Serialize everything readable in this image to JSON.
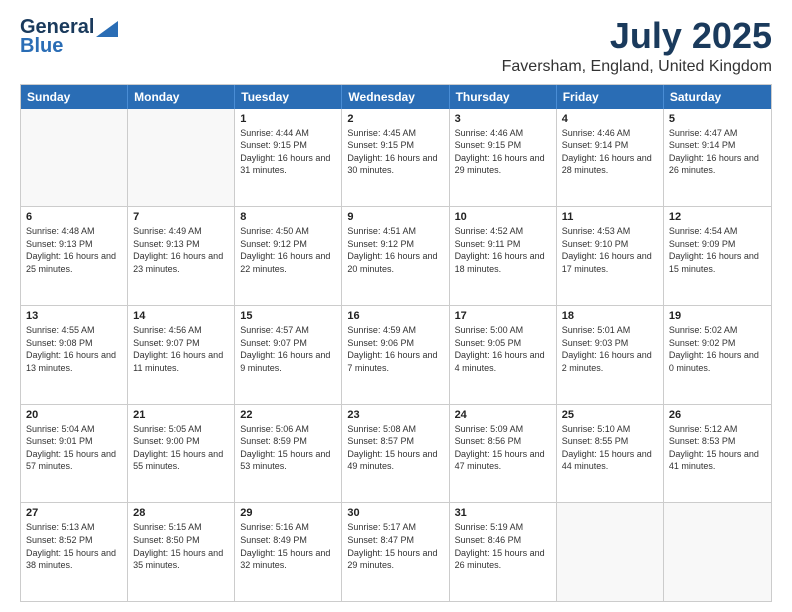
{
  "logo": {
    "name_part1": "General",
    "name_part2": "Blue",
    "tagline": "Blue"
  },
  "header": {
    "month": "July 2025",
    "location": "Faversham, England, United Kingdom"
  },
  "days_of_week": [
    "Sunday",
    "Monday",
    "Tuesday",
    "Wednesday",
    "Thursday",
    "Friday",
    "Saturday"
  ],
  "weeks": [
    [
      {
        "day": "",
        "empty": true
      },
      {
        "day": "",
        "empty": true
      },
      {
        "day": "1",
        "sunrise": "Sunrise: 4:44 AM",
        "sunset": "Sunset: 9:15 PM",
        "daylight": "Daylight: 16 hours and 31 minutes."
      },
      {
        "day": "2",
        "sunrise": "Sunrise: 4:45 AM",
        "sunset": "Sunset: 9:15 PM",
        "daylight": "Daylight: 16 hours and 30 minutes."
      },
      {
        "day": "3",
        "sunrise": "Sunrise: 4:46 AM",
        "sunset": "Sunset: 9:15 PM",
        "daylight": "Daylight: 16 hours and 29 minutes."
      },
      {
        "day": "4",
        "sunrise": "Sunrise: 4:46 AM",
        "sunset": "Sunset: 9:14 PM",
        "daylight": "Daylight: 16 hours and 28 minutes."
      },
      {
        "day": "5",
        "sunrise": "Sunrise: 4:47 AM",
        "sunset": "Sunset: 9:14 PM",
        "daylight": "Daylight: 16 hours and 26 minutes."
      }
    ],
    [
      {
        "day": "6",
        "sunrise": "Sunrise: 4:48 AM",
        "sunset": "Sunset: 9:13 PM",
        "daylight": "Daylight: 16 hours and 25 minutes."
      },
      {
        "day": "7",
        "sunrise": "Sunrise: 4:49 AM",
        "sunset": "Sunset: 9:13 PM",
        "daylight": "Daylight: 16 hours and 23 minutes."
      },
      {
        "day": "8",
        "sunrise": "Sunrise: 4:50 AM",
        "sunset": "Sunset: 9:12 PM",
        "daylight": "Daylight: 16 hours and 22 minutes."
      },
      {
        "day": "9",
        "sunrise": "Sunrise: 4:51 AM",
        "sunset": "Sunset: 9:12 PM",
        "daylight": "Daylight: 16 hours and 20 minutes."
      },
      {
        "day": "10",
        "sunrise": "Sunrise: 4:52 AM",
        "sunset": "Sunset: 9:11 PM",
        "daylight": "Daylight: 16 hours and 18 minutes."
      },
      {
        "day": "11",
        "sunrise": "Sunrise: 4:53 AM",
        "sunset": "Sunset: 9:10 PM",
        "daylight": "Daylight: 16 hours and 17 minutes."
      },
      {
        "day": "12",
        "sunrise": "Sunrise: 4:54 AM",
        "sunset": "Sunset: 9:09 PM",
        "daylight": "Daylight: 16 hours and 15 minutes."
      }
    ],
    [
      {
        "day": "13",
        "sunrise": "Sunrise: 4:55 AM",
        "sunset": "Sunset: 9:08 PM",
        "daylight": "Daylight: 16 hours and 13 minutes."
      },
      {
        "day": "14",
        "sunrise": "Sunrise: 4:56 AM",
        "sunset": "Sunset: 9:07 PM",
        "daylight": "Daylight: 16 hours and 11 minutes."
      },
      {
        "day": "15",
        "sunrise": "Sunrise: 4:57 AM",
        "sunset": "Sunset: 9:07 PM",
        "daylight": "Daylight: 16 hours and 9 minutes."
      },
      {
        "day": "16",
        "sunrise": "Sunrise: 4:59 AM",
        "sunset": "Sunset: 9:06 PM",
        "daylight": "Daylight: 16 hours and 7 minutes."
      },
      {
        "day": "17",
        "sunrise": "Sunrise: 5:00 AM",
        "sunset": "Sunset: 9:05 PM",
        "daylight": "Daylight: 16 hours and 4 minutes."
      },
      {
        "day": "18",
        "sunrise": "Sunrise: 5:01 AM",
        "sunset": "Sunset: 9:03 PM",
        "daylight": "Daylight: 16 hours and 2 minutes."
      },
      {
        "day": "19",
        "sunrise": "Sunrise: 5:02 AM",
        "sunset": "Sunset: 9:02 PM",
        "daylight": "Daylight: 16 hours and 0 minutes."
      }
    ],
    [
      {
        "day": "20",
        "sunrise": "Sunrise: 5:04 AM",
        "sunset": "Sunset: 9:01 PM",
        "daylight": "Daylight: 15 hours and 57 minutes."
      },
      {
        "day": "21",
        "sunrise": "Sunrise: 5:05 AM",
        "sunset": "Sunset: 9:00 PM",
        "daylight": "Daylight: 15 hours and 55 minutes."
      },
      {
        "day": "22",
        "sunrise": "Sunrise: 5:06 AM",
        "sunset": "Sunset: 8:59 PM",
        "daylight": "Daylight: 15 hours and 53 minutes."
      },
      {
        "day": "23",
        "sunrise": "Sunrise: 5:08 AM",
        "sunset": "Sunset: 8:57 PM",
        "daylight": "Daylight: 15 hours and 49 minutes."
      },
      {
        "day": "24",
        "sunrise": "Sunrise: 5:09 AM",
        "sunset": "Sunset: 8:56 PM",
        "daylight": "Daylight: 15 hours and 47 minutes."
      },
      {
        "day": "25",
        "sunrise": "Sunrise: 5:10 AM",
        "sunset": "Sunset: 8:55 PM",
        "daylight": "Daylight: 15 hours and 44 minutes."
      },
      {
        "day": "26",
        "sunrise": "Sunrise: 5:12 AM",
        "sunset": "Sunset: 8:53 PM",
        "daylight": "Daylight: 15 hours and 41 minutes."
      }
    ],
    [
      {
        "day": "27",
        "sunrise": "Sunrise: 5:13 AM",
        "sunset": "Sunset: 8:52 PM",
        "daylight": "Daylight: 15 hours and 38 minutes."
      },
      {
        "day": "28",
        "sunrise": "Sunrise: 5:15 AM",
        "sunset": "Sunset: 8:50 PM",
        "daylight": "Daylight: 15 hours and 35 minutes."
      },
      {
        "day": "29",
        "sunrise": "Sunrise: 5:16 AM",
        "sunset": "Sunset: 8:49 PM",
        "daylight": "Daylight: 15 hours and 32 minutes."
      },
      {
        "day": "30",
        "sunrise": "Sunrise: 5:17 AM",
        "sunset": "Sunset: 8:47 PM",
        "daylight": "Daylight: 15 hours and 29 minutes."
      },
      {
        "day": "31",
        "sunrise": "Sunrise: 5:19 AM",
        "sunset": "Sunset: 8:46 PM",
        "daylight": "Daylight: 15 hours and 26 minutes."
      },
      {
        "day": "",
        "empty": true
      },
      {
        "day": "",
        "empty": true
      }
    ]
  ]
}
